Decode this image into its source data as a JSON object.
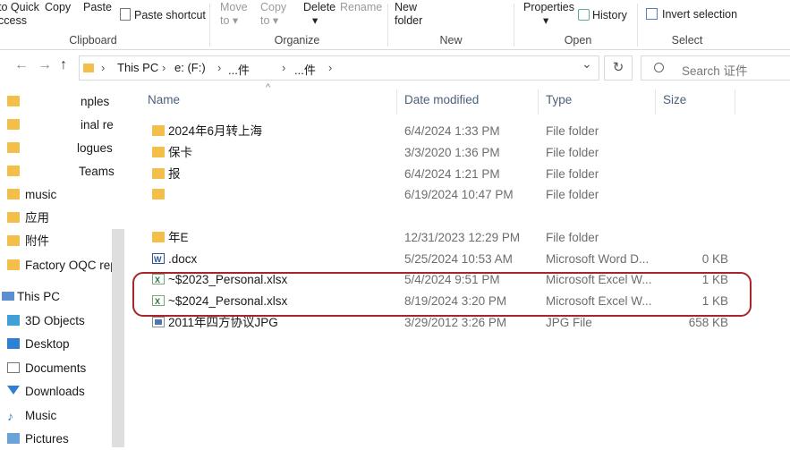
{
  "ribbon": {
    "quick_access_line1": "to Quick",
    "quick_access_line2": "ccess",
    "copy": "Copy",
    "paste": "Paste",
    "paste_shortcut": "Paste shortcut",
    "move_to_line1": "Move",
    "move_to_line2": "to",
    "copy_to_line1": "Copy",
    "copy_to_line2": "to",
    "delete": "Delete",
    "rename": "Rename",
    "new_folder_line1": "New",
    "new_folder_line2": "folder",
    "properties": "Properties",
    "history": "History",
    "invert_selection": "Invert selection",
    "groups": {
      "clipboard": "Clipboard",
      "organize": "Organize",
      "new": "New",
      "open": "Open",
      "select": "Select"
    }
  },
  "address": {
    "back": "←",
    "forward": "→",
    "up": "↑",
    "crumbs": [
      "This PC",
      "e: (F:)",
      "...件",
      "...件"
    ],
    "separator": "›",
    "dropdown": "⌄",
    "refresh": "↻",
    "search_placeholder": "Search 证件"
  },
  "nav": {
    "items": [
      {
        "label": "nples",
        "icon": "folder-icon"
      },
      {
        "label": "inal re",
        "icon": "folder-icon"
      },
      {
        "label": "logues",
        "icon": "folder-icon"
      },
      {
        "label": "Teams",
        "icon": "folder-icon"
      },
      {
        "label": "music",
        "icon": "folder-icon"
      },
      {
        "label": "应用",
        "icon": "folder-icon"
      },
      {
        "label": "附件",
        "icon": "folder-icon"
      },
      {
        "label": "Factory OQC rep",
        "icon": "folder-icon"
      },
      {
        "label": "This PC",
        "icon": "computer-icon"
      },
      {
        "label": "3D Objects",
        "icon": "cube-icon"
      },
      {
        "label": "Desktop",
        "icon": "desktop-icon"
      },
      {
        "label": "Documents",
        "icon": "documents-icon"
      },
      {
        "label": "Downloads",
        "icon": "download-icon"
      },
      {
        "label": "Music",
        "icon": "music-icon"
      },
      {
        "label": "Pictures",
        "icon": "pictures-icon"
      }
    ]
  },
  "columns": {
    "name": "Name",
    "date": "Date modified",
    "type": "Type",
    "size": "Size",
    "sort_indicator": "^"
  },
  "files": [
    {
      "name": "2024年6月转上海",
      "date": "6/4/2024 1:33 PM",
      "type": "File folder",
      "size": "",
      "icon": "folder-icon"
    },
    {
      "name": "保卡",
      "date": "3/3/2020 1:36 PM",
      "type": "File folder",
      "size": "",
      "icon": "folder-icon"
    },
    {
      "name": "报",
      "date": "6/4/2024 1:21 PM",
      "type": "File folder",
      "size": "",
      "icon": "folder-icon"
    },
    {
      "name": "",
      "date": "6/19/2024 10:47 PM",
      "type": "File folder",
      "size": "",
      "icon": "folder-icon"
    },
    {
      "name": "年E",
      "date": "12/31/2023 12:29 PM",
      "type": "File folder",
      "size": "",
      "icon": "folder-icon"
    },
    {
      "name": ".docx",
      "date": "5/25/2024 10:53 AM",
      "type": "Microsoft Word D...",
      "size": "0 KB",
      "icon": "word-icon"
    },
    {
      "name": "~$2023_Personal.xlsx",
      "date": "5/4/2024 9:51 PM",
      "type": "Microsoft Excel W...",
      "size": "1 KB",
      "icon": "excel-icon"
    },
    {
      "name": "~$2024_Personal.xlsx",
      "date": "8/19/2024 3:20 PM",
      "type": "Microsoft Excel W...",
      "size": "1 KB",
      "icon": "excel-icon"
    },
    {
      "name": "2011年四方协议JPG",
      "date": "3/29/2012 3:26 PM",
      "type": "JPG File",
      "size": "658 KB",
      "icon": "jpg-icon"
    }
  ],
  "colors": {
    "highlight": "#a6262a",
    "folder": "#f2c04a",
    "header_text": "#4c607a"
  }
}
